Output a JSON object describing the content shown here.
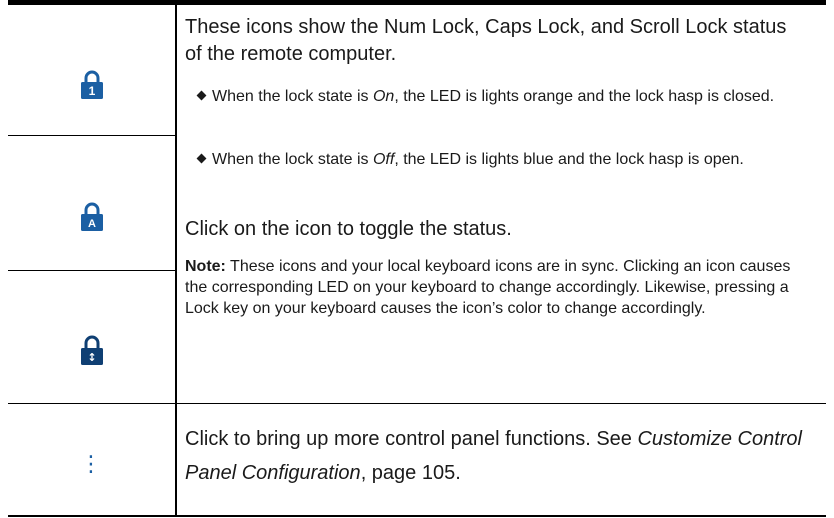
{
  "rows": {
    "lock_status": {
      "icons": [
        {
          "name": "num-lock-icon",
          "glyph": "1"
        },
        {
          "name": "caps-lock-icon",
          "glyph": "A"
        },
        {
          "name": "scroll-lock-icon",
          "glyph": "↕"
        }
      ],
      "intro": "These icons show the Num Lock, Caps Lock, and Scroll Lock status of the remote computer.",
      "bullet_on": {
        "pre": "When the lock state is ",
        "state": "On",
        "post": ", the LED is lights orange and the lock hasp is closed."
      },
      "bullet_off": {
        "pre": "When the lock state is ",
        "state": "Off",
        "post": ", the LED is lights blue and the lock hasp is open."
      },
      "toggle": "Click on the icon to toggle the status.",
      "note_label": "Note:",
      "note_text": " These icons and your local keyboard icons are in sync. Clicking an icon causes the corresponding LED on your keyboard to change accordingly. Likewise, pressing a Lock key on your keyboard causes the icon’s color to change accordingly."
    },
    "more_functions": {
      "icon": {
        "name": "more-options-icon",
        "glyph": "⋮"
      },
      "text_pre": "Click to bring up more control panel functions. See ",
      "link_title": "Customize Control Panel Configuration",
      "text_post": ", page 105."
    }
  },
  "colors": {
    "icon_blue": "#1b5fa3",
    "icon_dark": "#0f3f73",
    "rule": "#000000",
    "text": "#1a1a1a"
  }
}
